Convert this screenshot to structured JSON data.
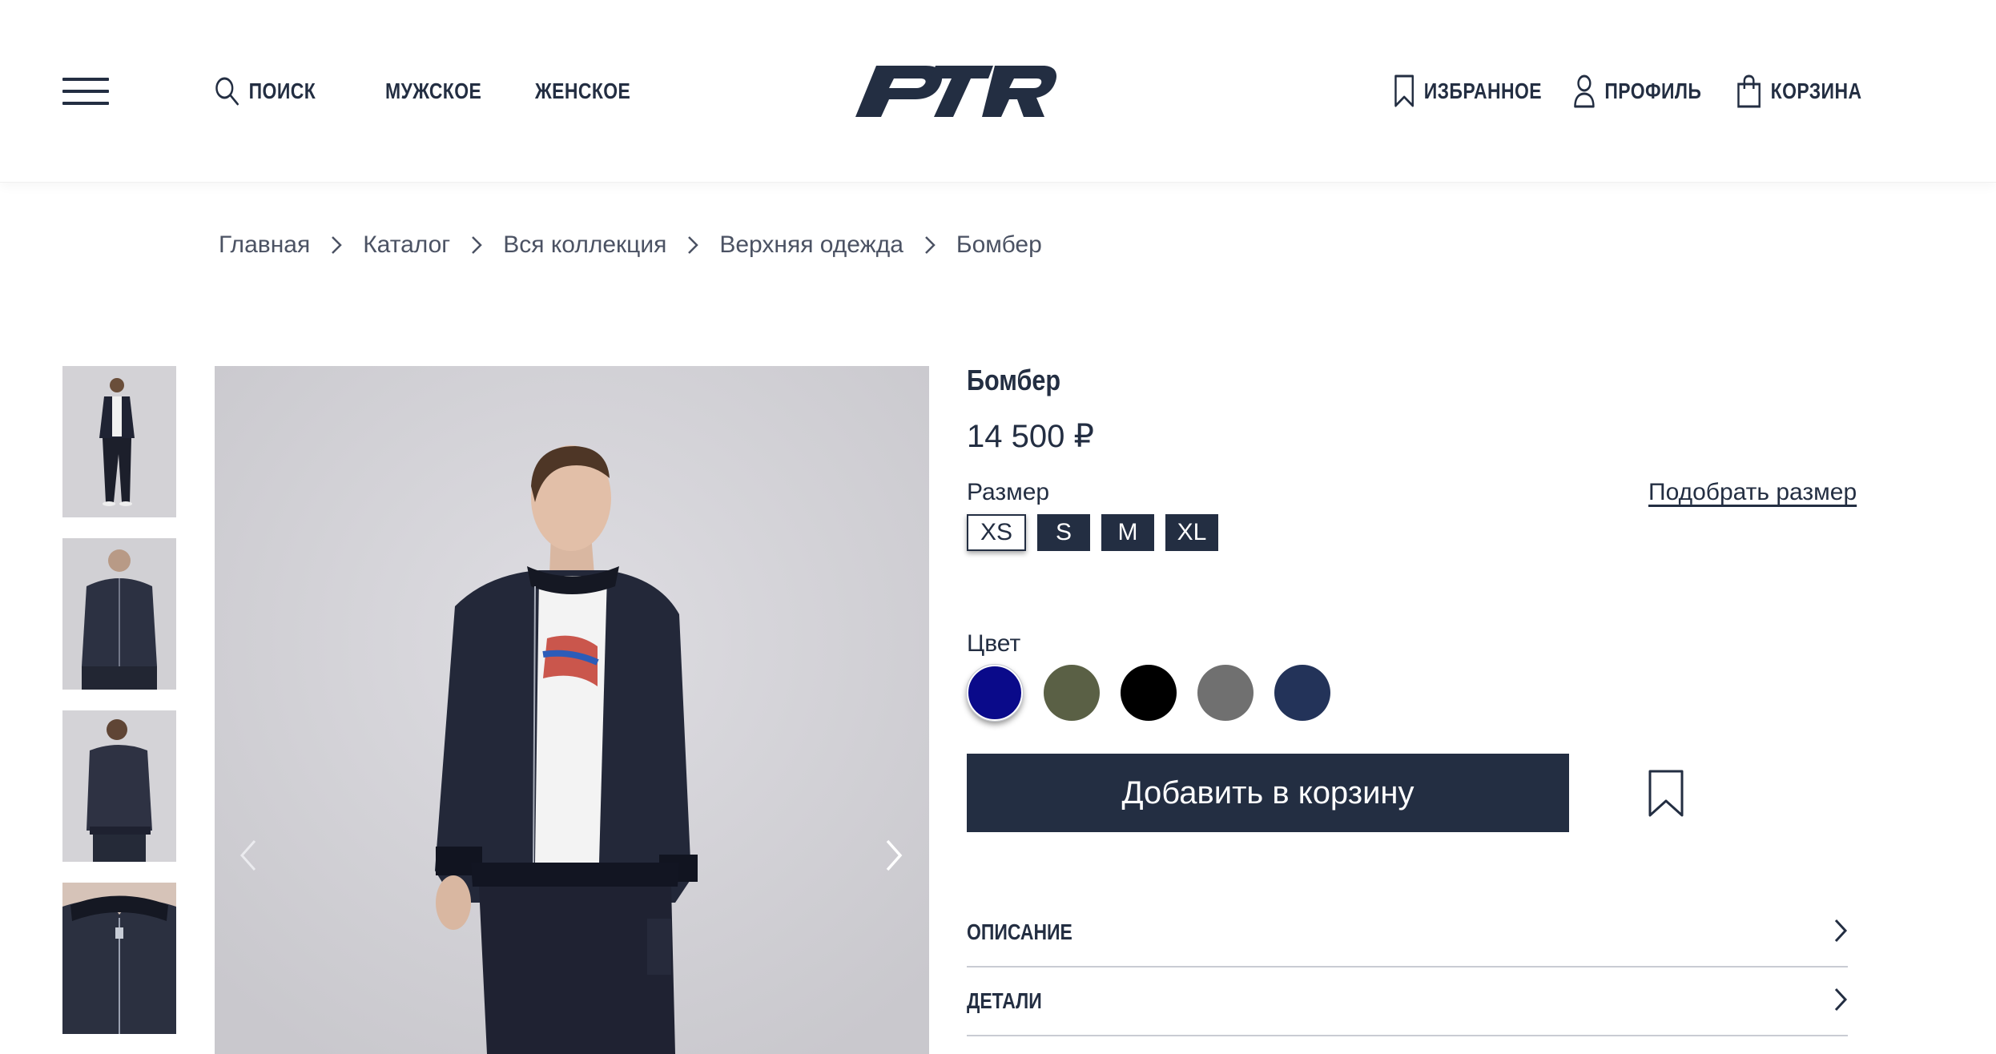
{
  "header": {
    "nav_left": [
      {
        "label": "ПОИСК",
        "icon": "search-icon"
      },
      {
        "label": "МУЖСКОЕ"
      },
      {
        "label": "ЖЕНСКОЕ"
      }
    ],
    "nav_right": [
      {
        "label": "ИЗБРАННОЕ",
        "icon": "bookmark-icon"
      },
      {
        "label": "ПРОФИЛЬ",
        "icon": "user-icon"
      },
      {
        "label": "КОРЗИНА",
        "icon": "shopping-bag-icon"
      }
    ],
    "logo_text": "PTR"
  },
  "breadcrumb": [
    "Главная",
    "Каталог",
    "Вся коллекция",
    "Верхняя одежда",
    "Бомбер"
  ],
  "product": {
    "title": "Бомбер",
    "price": "14 500 ₽",
    "size_label": "Размер",
    "size_guide_label": "Подобрать размер",
    "sizes": [
      "XS",
      "S",
      "M",
      "XL"
    ],
    "selected_size": "XS",
    "color_label": "Цвет",
    "colors": [
      "#0a0a8a",
      "#5a6045",
      "#000000",
      "#707070",
      "#233359"
    ],
    "selected_color_index": 0,
    "add_to_cart_label": "Добавить в корзину",
    "accordion": [
      "ОПИСАНИЕ",
      "ДЕТАЛИ"
    ]
  },
  "gallery": {
    "thumbnails": [
      "full-body-front",
      "front-closeup",
      "back-view",
      "collar-zip-detail"
    ]
  },
  "colors": {
    "primary": "#232e42",
    "text_muted": "#4b5263",
    "image_bg": "#d9d8dc"
  }
}
